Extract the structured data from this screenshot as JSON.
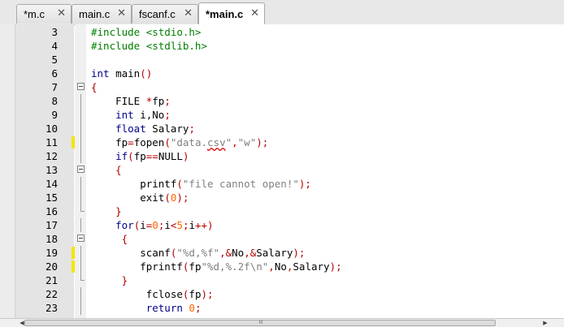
{
  "tabs": [
    {
      "label": "*m.c",
      "close": "✕",
      "active": false
    },
    {
      "label": "main.c",
      "close": "✕",
      "active": false
    },
    {
      "label": "fscanf.c",
      "close": "✕",
      "active": false
    },
    {
      "label": "*main.c",
      "close": "✕",
      "active": true
    }
  ],
  "lines": [
    {
      "num": "3",
      "mark": false,
      "fold": "none",
      "tokens": [
        {
          "t": "#include <stdio.h>",
          "c": "preproc"
        }
      ]
    },
    {
      "num": "4",
      "mark": false,
      "fold": "none",
      "tokens": [
        {
          "t": "#include <stdlib.h>",
          "c": "preproc"
        }
      ]
    },
    {
      "num": "5",
      "mark": false,
      "fold": "none",
      "tokens": []
    },
    {
      "num": "6",
      "mark": false,
      "fold": "none",
      "tokens": [
        {
          "t": "int",
          "c": "keyword"
        },
        {
          "t": " main",
          "c": "plain"
        },
        {
          "t": "()",
          "c": "operator"
        }
      ]
    },
    {
      "num": "7",
      "mark": false,
      "fold": "open",
      "tokens": [
        {
          "t": "{",
          "c": "operator"
        }
      ]
    },
    {
      "num": "8",
      "mark": false,
      "fold": "line",
      "tokens": [
        {
          "t": "    FILE ",
          "c": "plain"
        },
        {
          "t": "*",
          "c": "operator"
        },
        {
          "t": "fp",
          "c": "plain"
        },
        {
          "t": ";",
          "c": "operator"
        }
      ]
    },
    {
      "num": "9",
      "mark": false,
      "fold": "line",
      "tokens": [
        {
          "t": "    ",
          "c": "plain"
        },
        {
          "t": "int",
          "c": "keyword"
        },
        {
          "t": " i,No",
          "c": "plain"
        },
        {
          "t": ";",
          "c": "operator"
        }
      ]
    },
    {
      "num": "10",
      "mark": false,
      "fold": "line",
      "tokens": [
        {
          "t": "    ",
          "c": "plain"
        },
        {
          "t": "float",
          "c": "keyword"
        },
        {
          "t": " Salary",
          "c": "plain"
        },
        {
          "t": ";",
          "c": "operator"
        }
      ]
    },
    {
      "num": "11",
      "mark": true,
      "fold": "line",
      "tokens": [
        {
          "t": "    fp",
          "c": "plain"
        },
        {
          "t": "=",
          "c": "operator"
        },
        {
          "t": "fopen",
          "c": "plain"
        },
        {
          "t": "(",
          "c": "operator"
        },
        {
          "t": "\"data.",
          "c": "string"
        },
        {
          "t": "csv",
          "c": "squiggle"
        },
        {
          "t": "\"",
          "c": "string"
        },
        {
          "t": ",",
          "c": "operator"
        },
        {
          "t": "\"w\"",
          "c": "string"
        },
        {
          "t": ");",
          "c": "operator"
        }
      ]
    },
    {
      "num": "12",
      "mark": false,
      "fold": "line",
      "tokens": [
        {
          "t": "    ",
          "c": "plain"
        },
        {
          "t": "if",
          "c": "keyword"
        },
        {
          "t": "(",
          "c": "operator"
        },
        {
          "t": "fp",
          "c": "plain"
        },
        {
          "t": "==",
          "c": "operator"
        },
        {
          "t": "NULL",
          "c": "plain"
        },
        {
          "t": ")",
          "c": "operator"
        }
      ]
    },
    {
      "num": "13",
      "mark": false,
      "fold": "open",
      "tokens": [
        {
          "t": "    ",
          "c": "plain"
        },
        {
          "t": "{",
          "c": "operator"
        }
      ]
    },
    {
      "num": "14",
      "mark": false,
      "fold": "line",
      "tokens": [
        {
          "t": "        printf",
          "c": "plain"
        },
        {
          "t": "(",
          "c": "operator"
        },
        {
          "t": "\"file cannot open!\"",
          "c": "string"
        },
        {
          "t": ");",
          "c": "operator"
        }
      ]
    },
    {
      "num": "15",
      "mark": false,
      "fold": "line",
      "tokens": [
        {
          "t": "        exit",
          "c": "plain"
        },
        {
          "t": "(",
          "c": "operator"
        },
        {
          "t": "0",
          "c": "number"
        },
        {
          "t": ");",
          "c": "operator"
        }
      ]
    },
    {
      "num": "16",
      "mark": false,
      "fold": "end",
      "tokens": [
        {
          "t": "    ",
          "c": "plain"
        },
        {
          "t": "}",
          "c": "operator"
        }
      ]
    },
    {
      "num": "17",
      "mark": false,
      "fold": "line",
      "tokens": [
        {
          "t": "    ",
          "c": "plain"
        },
        {
          "t": "for",
          "c": "keyword"
        },
        {
          "t": "(",
          "c": "operator"
        },
        {
          "t": "i",
          "c": "plain"
        },
        {
          "t": "=",
          "c": "operator"
        },
        {
          "t": "0",
          "c": "number"
        },
        {
          "t": ";",
          "c": "operator"
        },
        {
          "t": "i",
          "c": "plain"
        },
        {
          "t": "<",
          "c": "operator"
        },
        {
          "t": "5",
          "c": "number"
        },
        {
          "t": ";",
          "c": "operator"
        },
        {
          "t": "i",
          "c": "plain"
        },
        {
          "t": "++)",
          "c": "operator"
        }
      ]
    },
    {
      "num": "18",
      "mark": false,
      "fold": "open",
      "tokens": [
        {
          "t": "     ",
          "c": "plain"
        },
        {
          "t": "{",
          "c": "operator"
        }
      ]
    },
    {
      "num": "19",
      "mark": true,
      "fold": "line",
      "tokens": [
        {
          "t": "        scanf",
          "c": "plain"
        },
        {
          "t": "(",
          "c": "operator"
        },
        {
          "t": "\"%d,%f\"",
          "c": "string"
        },
        {
          "t": ",&",
          "c": "operator"
        },
        {
          "t": "No",
          "c": "plain"
        },
        {
          "t": ",&",
          "c": "operator"
        },
        {
          "t": "Salary",
          "c": "plain"
        },
        {
          "t": ");",
          "c": "operator"
        }
      ]
    },
    {
      "num": "20",
      "mark": true,
      "fold": "line",
      "tokens": [
        {
          "t": "        fprintf",
          "c": "plain"
        },
        {
          "t": "(",
          "c": "operator"
        },
        {
          "t": "fp",
          "c": "plain"
        },
        {
          "t": "\"%d,%.2f\\n\"",
          "c": "string"
        },
        {
          "t": ",",
          "c": "operator"
        },
        {
          "t": "No",
          "c": "plain"
        },
        {
          "t": ",",
          "c": "operator"
        },
        {
          "t": "Salary",
          "c": "plain"
        },
        {
          "t": ");",
          "c": "operator"
        }
      ]
    },
    {
      "num": "21",
      "mark": false,
      "fold": "end",
      "tokens": [
        {
          "t": "     ",
          "c": "plain"
        },
        {
          "t": "}",
          "c": "operator"
        }
      ]
    },
    {
      "num": "22",
      "mark": false,
      "fold": "line",
      "tokens": [
        {
          "t": "         fclose",
          "c": "plain"
        },
        {
          "t": "(",
          "c": "operator"
        },
        {
          "t": "fp",
          "c": "plain"
        },
        {
          "t": ");",
          "c": "operator"
        }
      ]
    },
    {
      "num": "23",
      "mark": false,
      "fold": "line",
      "tokens": [
        {
          "t": "         ",
          "c": "plain"
        },
        {
          "t": "return",
          "c": "keyword"
        },
        {
          "t": " ",
          "c": "plain"
        },
        {
          "t": "0",
          "c": "number"
        },
        {
          "t": ";",
          "c": "operator"
        }
      ]
    }
  ],
  "scrollbar": {
    "left_arrow": "◀",
    "right_arrow": "▶",
    "grip": "III"
  },
  "colors": {
    "preproc": "#008000",
    "keyword": "#00008b",
    "string": "#808080",
    "operator": "#b40000",
    "number": "#ff6600",
    "change_marker": "#f3e600"
  }
}
